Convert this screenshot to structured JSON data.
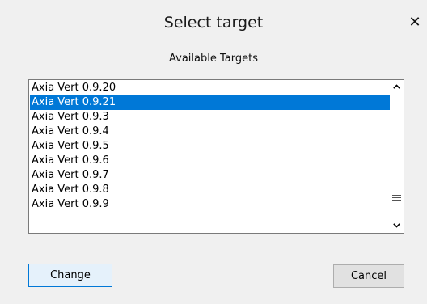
{
  "dialog": {
    "title": "Select target",
    "close_glyph": "✕",
    "subtitle": "Available Targets"
  },
  "targets": {
    "items": [
      "Axia Vert 0.9.20",
      "Axia Vert 0.9.21",
      "Axia Vert 0.9.3",
      "Axia Vert 0.9.4",
      "Axia Vert 0.9.5",
      "Axia Vert 0.9.6",
      "Axia Vert 0.9.7",
      "Axia Vert 0.9.8",
      "Axia Vert 0.9.9"
    ],
    "selected_index": 1
  },
  "icons": {
    "close": "close-icon",
    "scroll_up": "chevron-up-icon",
    "scroll_down": "chevron-down-icon",
    "scroll_thumb": "grip-icon"
  },
  "buttons": {
    "change_label": "Change",
    "cancel_label": "Cancel"
  },
  "colors": {
    "selection": "#0078d7",
    "selection_text": "#ffffff",
    "default_button_border": "#0078d7",
    "background": "#f0f0f0"
  }
}
